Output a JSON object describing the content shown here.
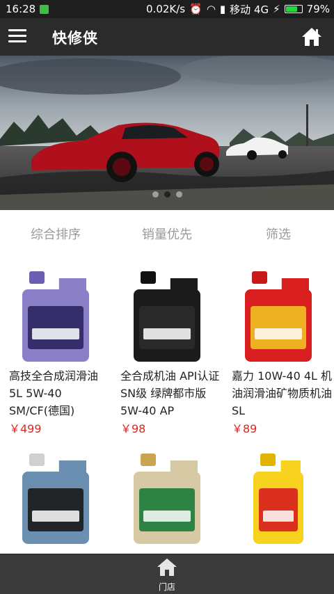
{
  "status": {
    "time": "16:28",
    "speed": "0.02K/s",
    "carrier": "移动 4G",
    "battery": "79%",
    "battery_level": 0.79
  },
  "header": {
    "title": "快修侠",
    "menu_icon": "hamburger-icon",
    "home_icon": "home-icon"
  },
  "banner": {
    "slides": 3,
    "active_index": 1
  },
  "sort": {
    "tabs": [
      "综合排序",
      "销量优先",
      "筛选"
    ]
  },
  "products": [
    {
      "name": "高技全合成润滑油5L 5W-40 SM/CF(德国)",
      "price": "￥499",
      "colors": {
        "body": "#8b7fc7",
        "cap": "#6a5fb3",
        "label": "#2a2660"
      }
    },
    {
      "name": "全合成机油 API认证SN级 绿牌都市版5W-40 AP",
      "price": "￥98",
      "colors": {
        "body": "#1b1b1b",
        "cap": "#111111",
        "label": "#2b2b2b"
      }
    },
    {
      "name": "嘉力 10W-40 4L 机油润滑油矿物质机油SL",
      "price": "￥89",
      "colors": {
        "body": "#d81e1e",
        "cap": "#c81818",
        "label": "#f0c020"
      }
    },
    {
      "name": "",
      "price": "",
      "colors": {
        "body": "#6a8fb0",
        "cap": "#d0d0d0",
        "label": "#1a1a1a"
      }
    },
    {
      "name": "",
      "price": "",
      "colors": {
        "body": "#d6c9a4",
        "cap": "#c9a552",
        "label": "#1c7a3a"
      }
    },
    {
      "name": "",
      "price": "",
      "colors": {
        "body": "#f7d21e",
        "cap": "#e2b300",
        "label": "#d81e1e"
      }
    }
  ],
  "bottom_nav": {
    "store_label": "门店",
    "store_icon": "store-home-icon"
  }
}
